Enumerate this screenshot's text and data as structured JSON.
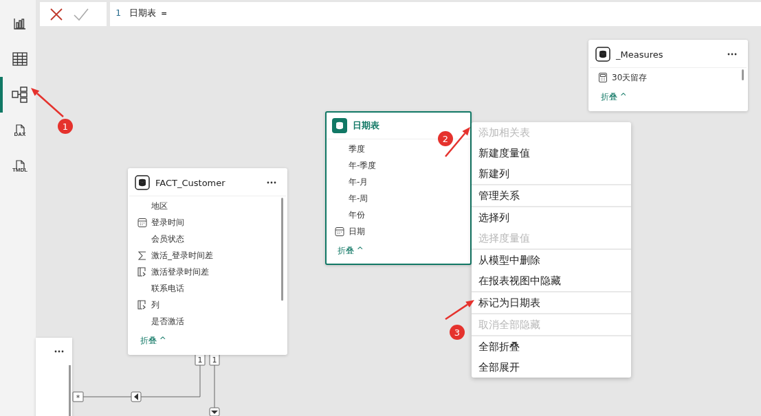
{
  "sidebar": {
    "items": [
      {
        "kind": "report",
        "selected": false
      },
      {
        "kind": "table",
        "selected": false
      },
      {
        "kind": "model",
        "selected": true
      },
      {
        "kind": "file",
        "label": "DAX",
        "selected": false
      },
      {
        "kind": "file",
        "label": "TMDL",
        "selected": false
      }
    ]
  },
  "formula_bar": {
    "lines": [
      {
        "number": "1",
        "code": "日期表 ="
      }
    ]
  },
  "tables": [
    {
      "title": "_Measures",
      "selected": false,
      "scrollbar": true,
      "fields": [
        {
          "kind": "measure",
          "name": "30天留存"
        }
      ],
      "collapse": "折叠 ^"
    },
    {
      "title": "日期表",
      "selected": true,
      "scrollbar": false,
      "fields": [
        {
          "kind": "plain",
          "name": "季度"
        },
        {
          "kind": "plain",
          "name": "年-季度"
        },
        {
          "kind": "plain",
          "name": "年-月"
        },
        {
          "kind": "plain",
          "name": "年-周"
        },
        {
          "kind": "plain",
          "name": "年份"
        },
        {
          "kind": "date",
          "name": "日期"
        }
      ],
      "collapse": "折叠 ^"
    },
    {
      "title": "FACT_Customer",
      "selected": false,
      "scrollbar": true,
      "fields": [
        {
          "kind": "plain",
          "name": "地区"
        },
        {
          "kind": "date",
          "name": "登录时间"
        },
        {
          "kind": "plain",
          "name": "会员状态"
        },
        {
          "kind": "sum",
          "name": "激活_登录时间差"
        },
        {
          "kind": "calc",
          "name": "激活登录时间差"
        },
        {
          "kind": "plain",
          "name": "联系电话"
        },
        {
          "kind": "calc",
          "name": "列"
        },
        {
          "kind": "plain",
          "name": "是否激活"
        }
      ],
      "collapse": "折叠 ^"
    }
  ],
  "relationships": [
    {
      "start_label": "1",
      "end_label": "*"
    },
    {
      "start_label": "1"
    }
  ],
  "context_menu": {
    "groups": [
      [
        {
          "label": "添加相关表",
          "disabled": true
        },
        {
          "label": "新建度量值",
          "disabled": false
        },
        {
          "label": "新建列",
          "disabled": false
        }
      ],
      [
        {
          "label": "管理关系",
          "disabled": false
        }
      ],
      [
        {
          "label": "选择列",
          "disabled": false
        },
        {
          "label": "选择度量值",
          "disabled": true
        }
      ],
      [
        {
          "label": "从模型中删除",
          "disabled": false
        },
        {
          "label": "在报表视图中隐藏",
          "disabled": false
        }
      ],
      [
        {
          "label": "标记为日期表",
          "disabled": false
        }
      ],
      [
        {
          "label": "取消全部隐藏",
          "disabled": true
        }
      ],
      [
        {
          "label": "全部折叠",
          "disabled": false
        },
        {
          "label": "全部展开",
          "disabled": false
        }
      ]
    ]
  },
  "annotations": [
    {
      "label": "1"
    },
    {
      "label": "2"
    },
    {
      "label": "3"
    }
  ]
}
